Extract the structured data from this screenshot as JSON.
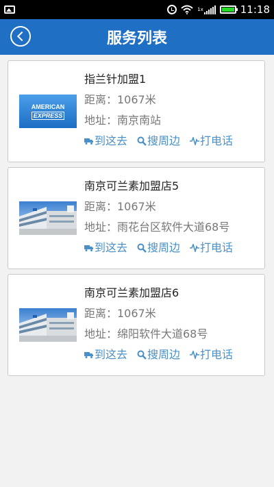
{
  "status_bar": {
    "time": "11:18",
    "network_type": "1x",
    "icons": [
      "image-icon",
      "alarm-icon",
      "wifi-icon",
      "signal-icon",
      "battery-icon"
    ]
  },
  "header": {
    "title": "服务列表",
    "back_icon": "chevron-left-icon",
    "background_color": "#1f6fc4"
  },
  "cards": [
    {
      "name": "指兰针加盟1",
      "distance": "距离：1067米",
      "address": "地址：南京南站",
      "image": "american-express-logo",
      "amex_line1": "AMERICAN",
      "amex_line2": "EXPRESS",
      "actions": [
        "到这去",
        "搜周边",
        "打电话"
      ]
    },
    {
      "name": "南京可兰素加盟店5",
      "distance": "距离：1067米",
      "address": "地址：雨花台区软件大道68号",
      "image": "building-photo",
      "actions": [
        "到这去",
        "搜周边",
        "打电话"
      ]
    },
    {
      "name": "南京可兰素加盟店6",
      "distance": "距离：1067米",
      "address": "地址：绵阳软件大道68号",
      "image": "building-photo",
      "actions": [
        "到这去",
        "搜周边",
        "打电话"
      ]
    }
  ],
  "action_icons": [
    "truck-icon",
    "search-icon",
    "phone-wave-icon"
  ],
  "accent_color": "#4a90c8"
}
